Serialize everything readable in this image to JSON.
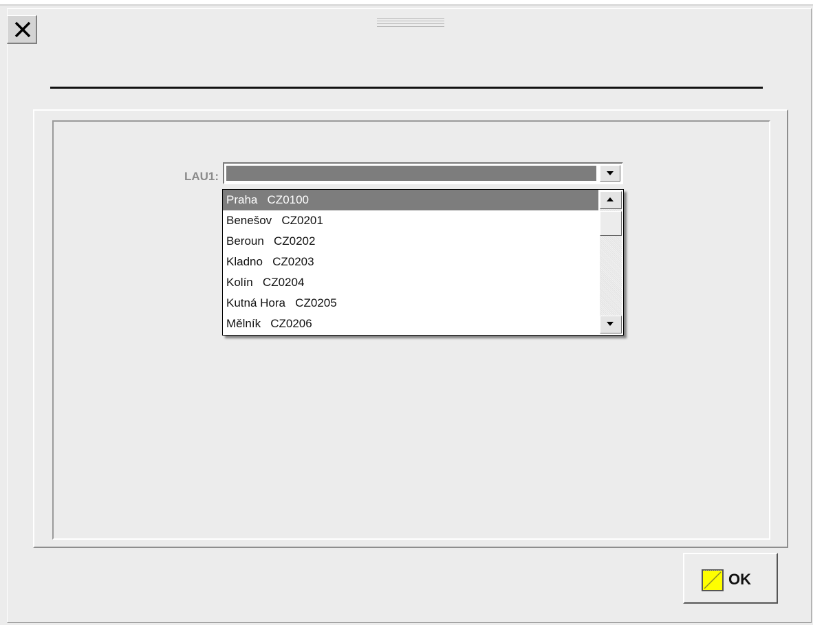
{
  "dialog": {
    "close_glyph": "✕",
    "field_label": "LAU1:",
    "combo_value": "",
    "ok_label": "OK"
  },
  "dropdown": {
    "items": [
      {
        "label": "Praha   CZ0100",
        "selected": true
      },
      {
        "label": "Benešov   CZ0201",
        "selected": false
      },
      {
        "label": "Beroun   CZ0202",
        "selected": false
      },
      {
        "label": "Kladno   CZ0203",
        "selected": false
      },
      {
        "label": "Kolín   CZ0204",
        "selected": false
      },
      {
        "label": "Kutná Hora   CZ0205",
        "selected": false
      },
      {
        "label": "Mělník   CZ0206",
        "selected": false
      }
    ]
  },
  "colors": {
    "selection": "#7d7d7d",
    "ok_icon": "#ffff00",
    "background": "#ececec"
  },
  "icons": {
    "close": "close-icon",
    "combo_arrow": "chevron-down-icon",
    "scroll_up": "scroll-up-icon",
    "scroll_down": "scroll-down-icon",
    "ok": "ok-check-icon"
  }
}
